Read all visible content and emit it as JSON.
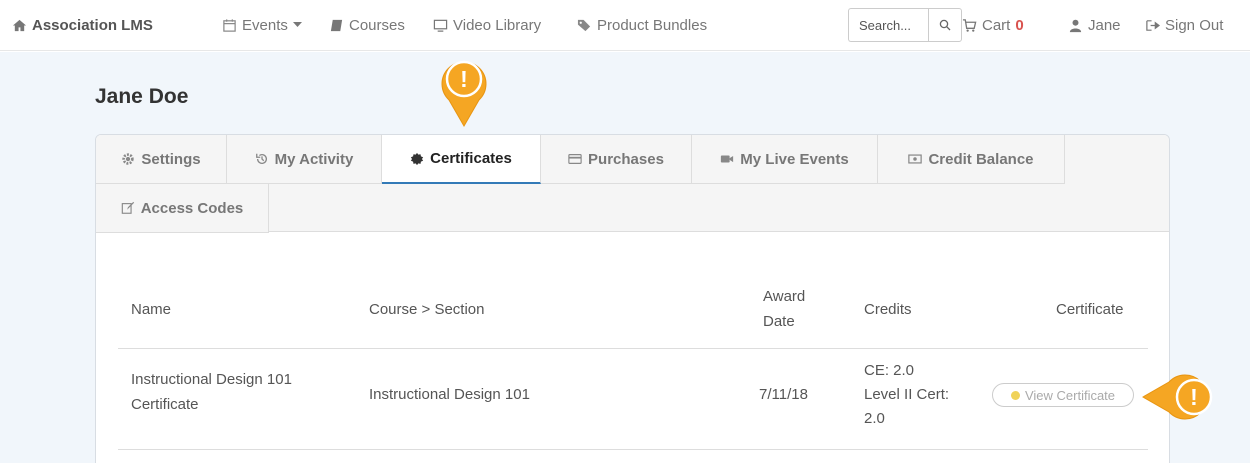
{
  "nav": {
    "brand": "Association LMS",
    "events": "Events",
    "courses": "Courses",
    "video_library": "Video Library",
    "product_bundles": "Product Bundles",
    "search_placeholder": "Search...",
    "cart_label": "Cart",
    "cart_count": "0",
    "user": "Jane",
    "sign_out": "Sign Out"
  },
  "page": {
    "title": "Jane Doe"
  },
  "tabs": [
    {
      "label": "Settings",
      "icon": "gear-icon"
    },
    {
      "label": "My Activity",
      "icon": "history-icon"
    },
    {
      "label": "Certificates",
      "icon": "certificate-icon",
      "active": true
    },
    {
      "label": "Purchases",
      "icon": "credit-card-icon"
    },
    {
      "label": "My Live Events",
      "icon": "video-camera-icon"
    },
    {
      "label": "Credit Balance",
      "icon": "money-icon"
    },
    {
      "label": "Access Codes",
      "icon": "edit-icon"
    }
  ],
  "table": {
    "headers": {
      "name": "Name",
      "course_section": "Course > Section",
      "award_date_line1": "Award",
      "award_date_line2": "Date",
      "credits": "Credits",
      "certificate": "Certificate"
    },
    "rows": [
      {
        "name_line1": "Instructional Design 101",
        "name_line2": "Certificate",
        "course_section": "Instructional Design 101",
        "award_date": "7/11/18",
        "credits_line1": "CE: 2.0",
        "credits_line2": "Level II Cert:",
        "credits_line3": "2.0",
        "certificate_label": "View Certificate"
      }
    ]
  },
  "hotspot": {
    "symbol": "!",
    "color": "#f5a623"
  },
  "colors": {
    "accent": "#337ab7",
    "cart_count": "#d9534f",
    "page_bg": "#f1f6fb"
  }
}
